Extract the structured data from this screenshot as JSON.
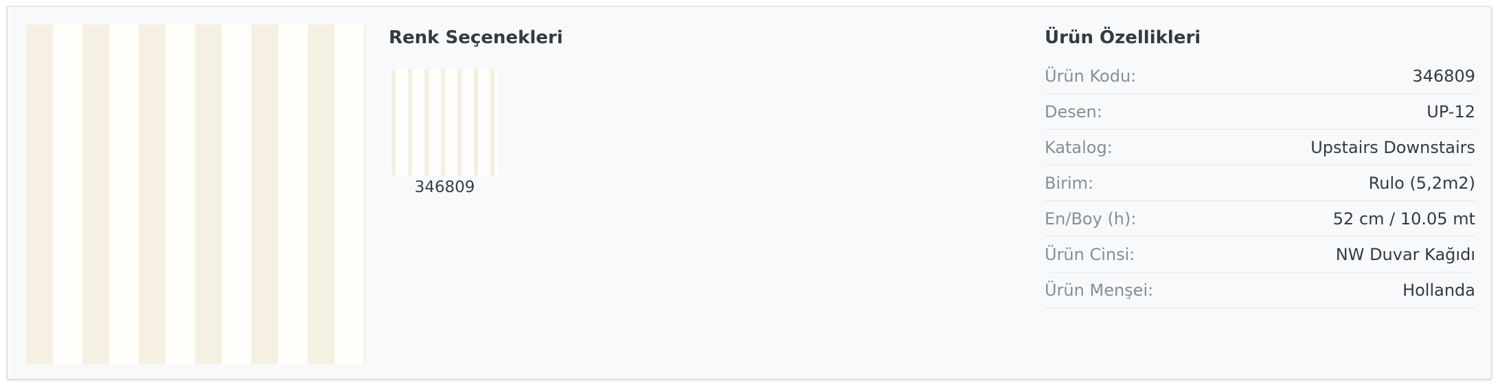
{
  "colors_section": {
    "title": "Renk Seçenekleri",
    "swatches": [
      {
        "label": "346809"
      }
    ]
  },
  "properties_section": {
    "title": "Ürün Özellikleri",
    "rows": [
      {
        "key": "Ürün Kodu:",
        "value": "346809"
      },
      {
        "key": "Desen:",
        "value": "UP-12"
      },
      {
        "key": "Katalog:",
        "value": "Upstairs Downstairs"
      },
      {
        "key": "Birim:",
        "value": "Rulo (5,2m2)"
      },
      {
        "key": "En/Boy (h):",
        "value": "52 cm / 10.05 mt"
      },
      {
        "key": "Ürün Cinsi:",
        "value": "NW Duvar Kağıdı"
      },
      {
        "key": "Ürün Menşei:",
        "value": "Hollanda"
      }
    ]
  },
  "colors": {
    "stripe_cream": "#f5f0e1",
    "stripe_white": "#fffefa",
    "panel_background": "#f8f9fa"
  }
}
